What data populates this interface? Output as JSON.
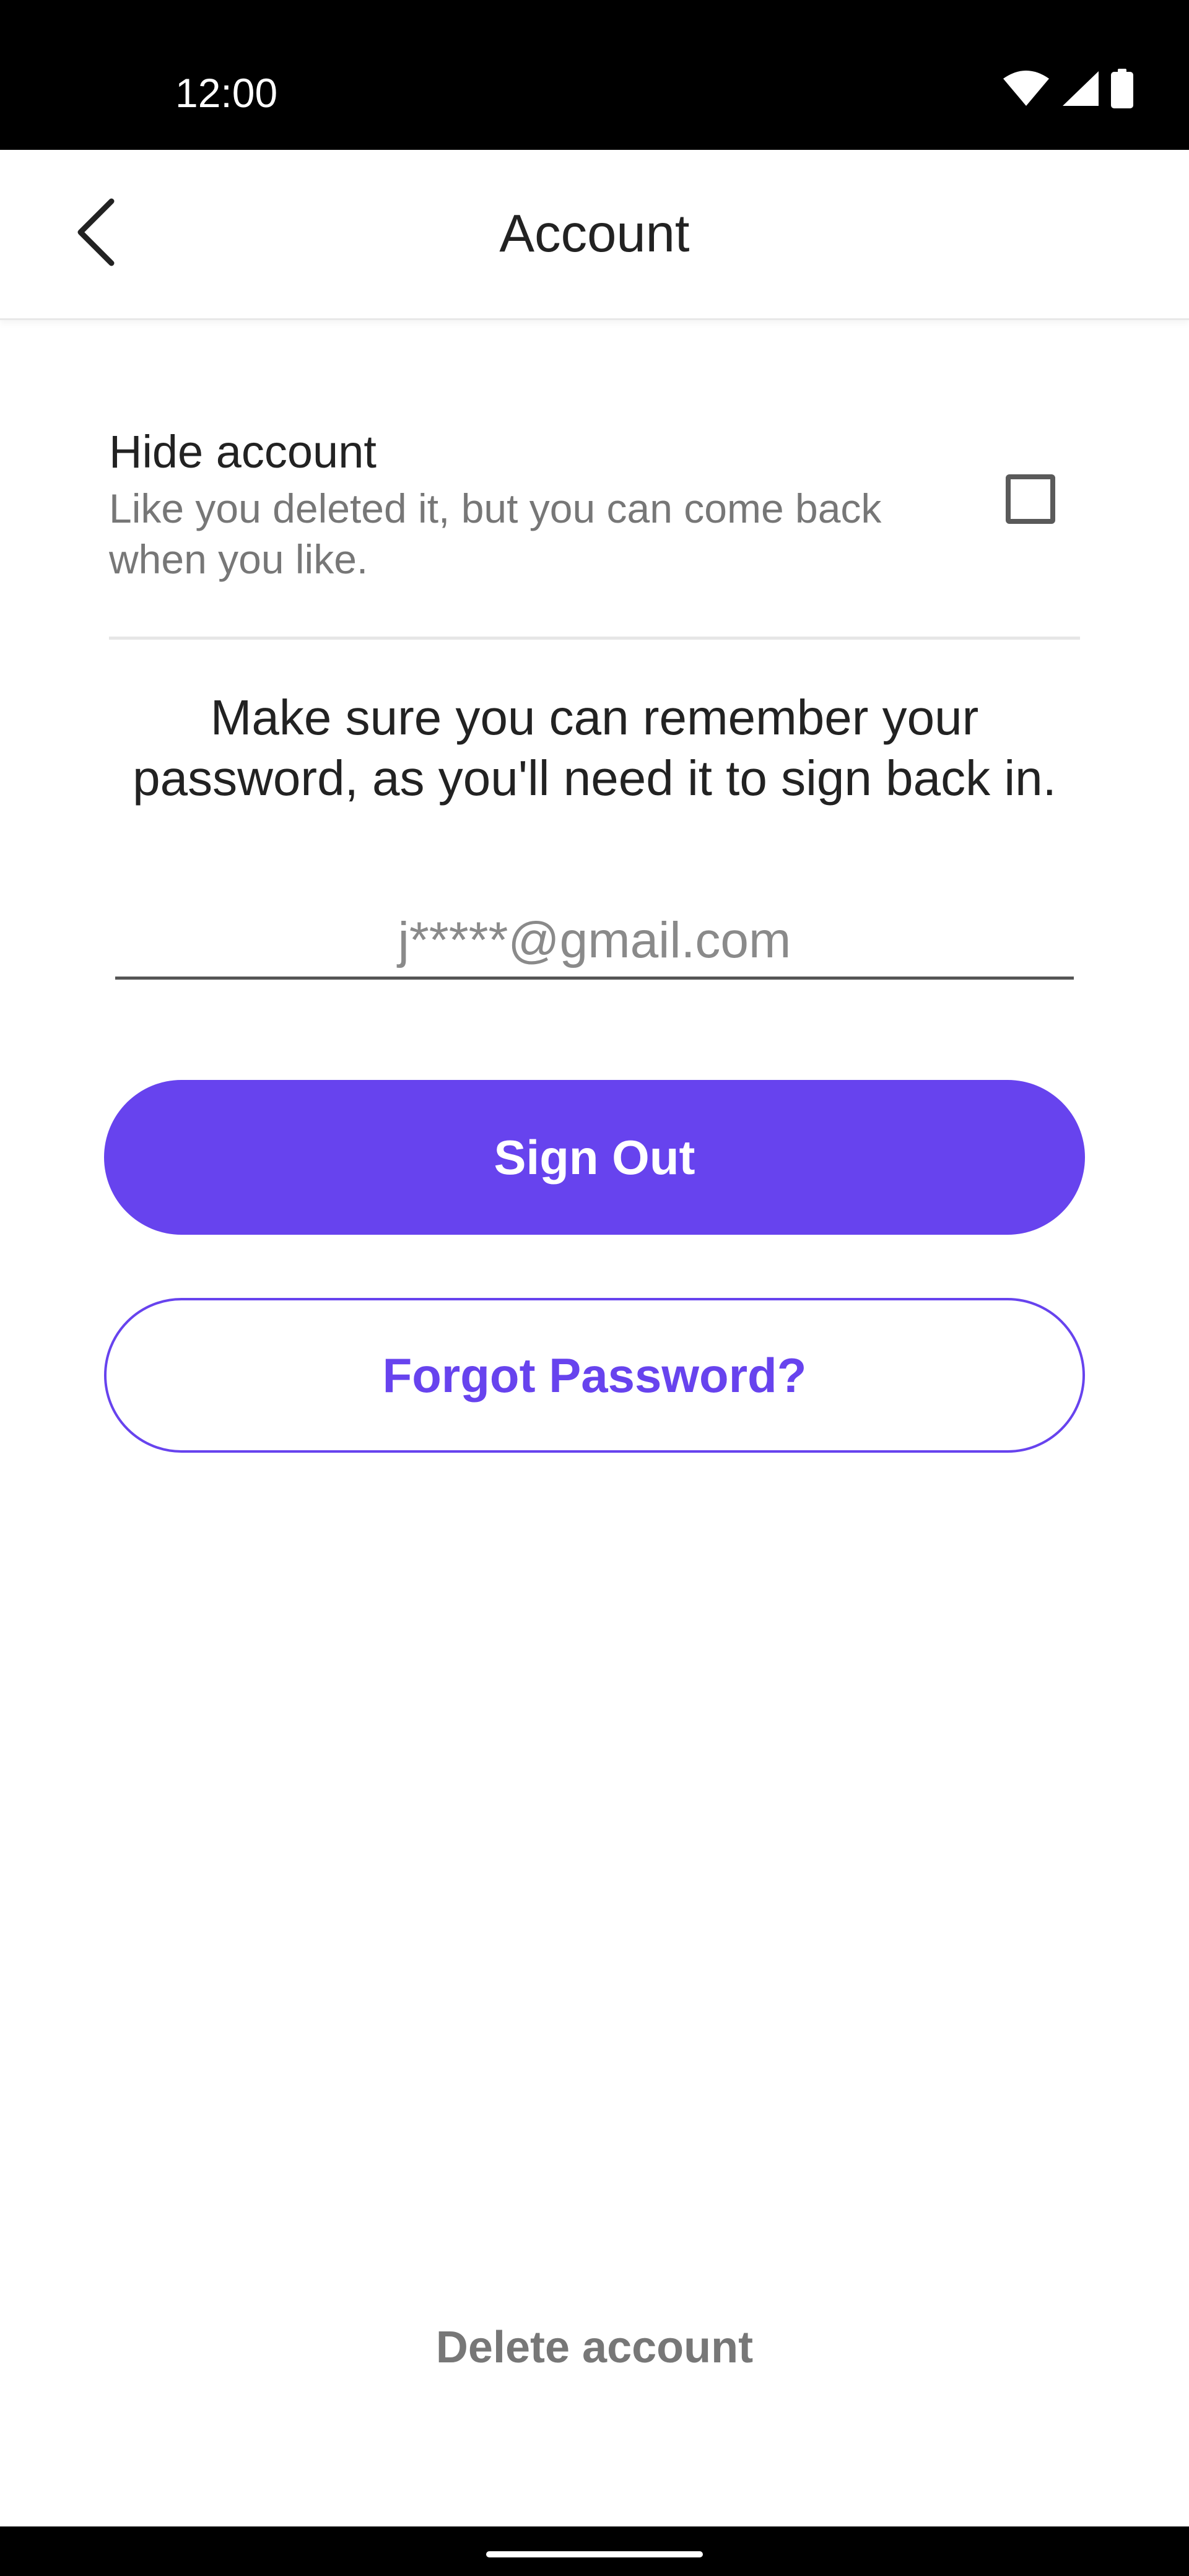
{
  "status_bar": {
    "time": "12:00",
    "icons": [
      "wifi-icon",
      "signal-icon",
      "battery-icon"
    ]
  },
  "header": {
    "title": "Account",
    "back_icon": "chevron-left-icon"
  },
  "hide_account": {
    "title": "Hide account",
    "description": "Like you deleted it, but you can come back when you like.",
    "checked": false
  },
  "info": {
    "text": "Make sure you can remember your password, as you'll need it to sign back in."
  },
  "email": {
    "placeholder": "j*****@gmail.com",
    "value": ""
  },
  "buttons": {
    "sign_out": "Sign Out",
    "forgot_password": "Forgot Password?"
  },
  "footer": {
    "delete_account": "Delete account"
  },
  "colors": {
    "accent": "#6743ee",
    "text_primary": "#222222",
    "text_secondary": "#777777"
  }
}
